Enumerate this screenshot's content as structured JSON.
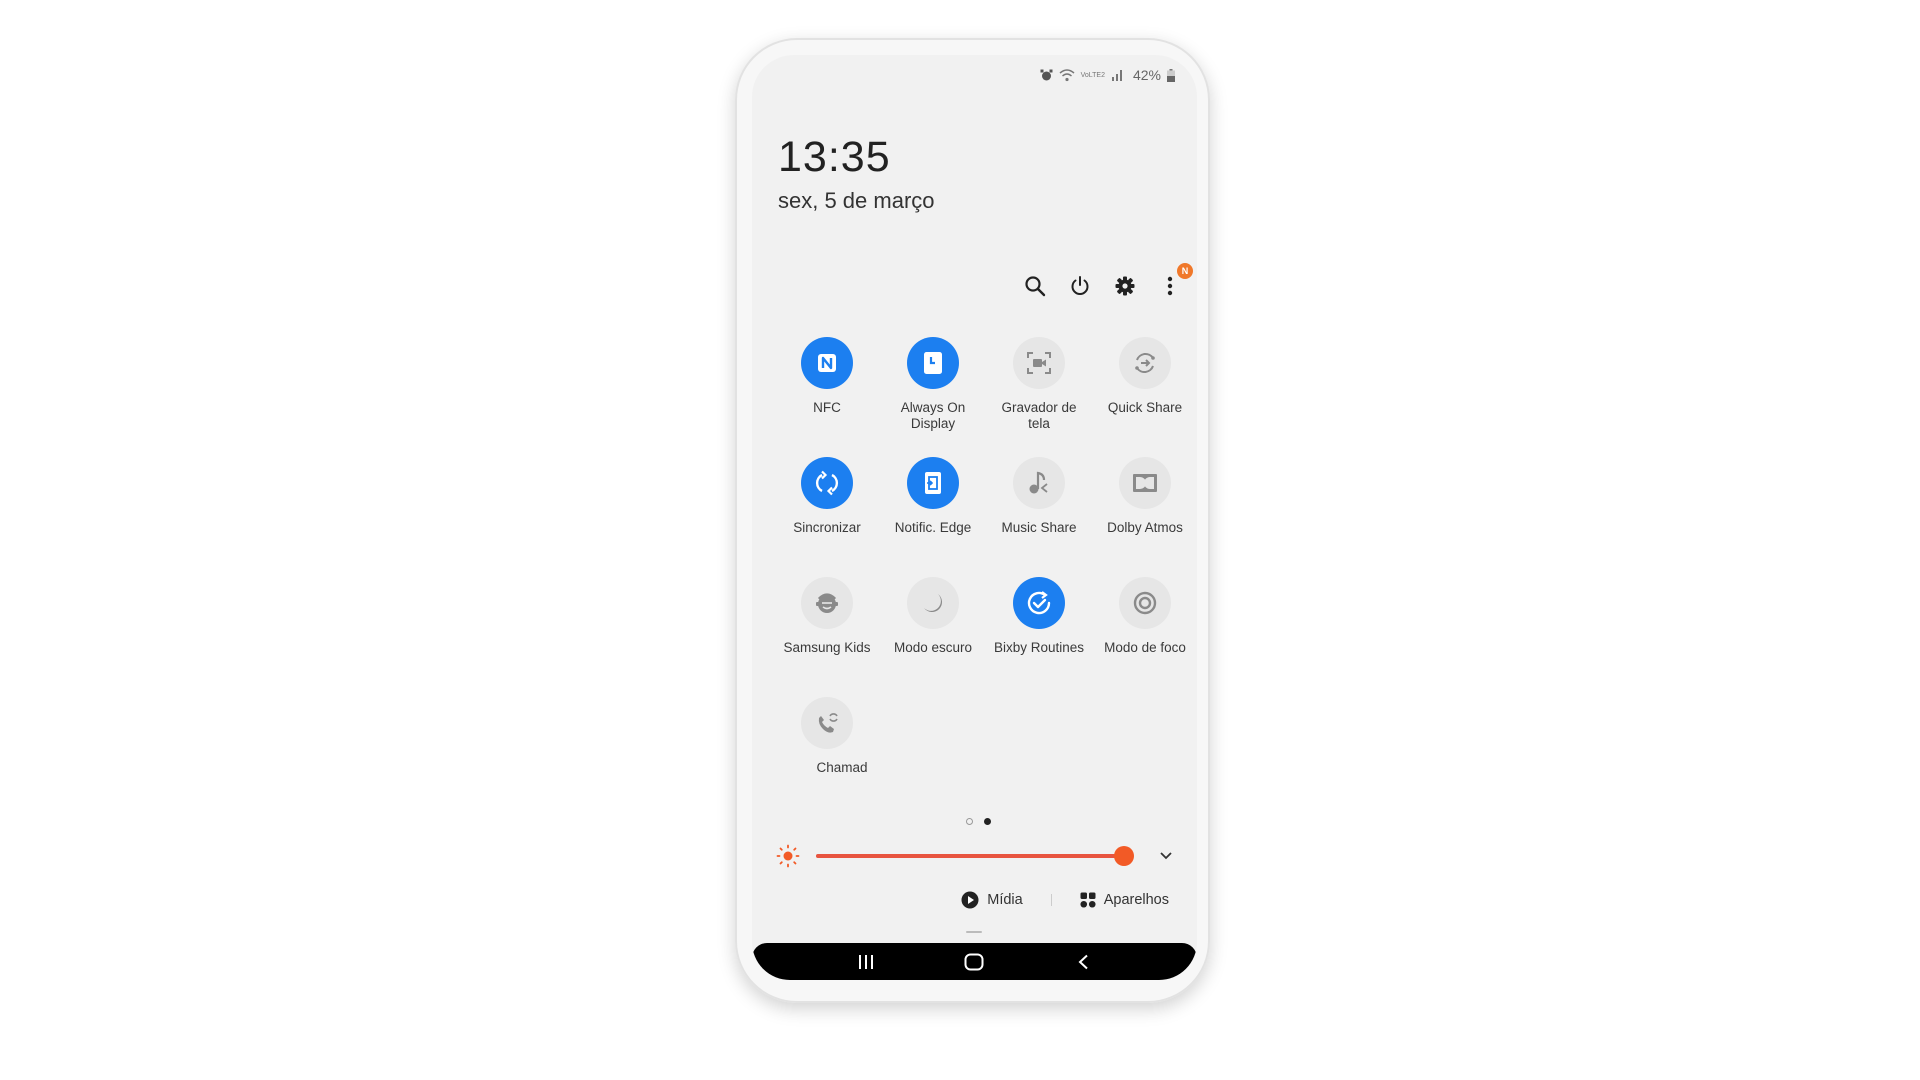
{
  "status_bar": {
    "icons": [
      "alarm-icon",
      "wifi-icon",
      "volte-lte-icon",
      "signal-icon"
    ],
    "volte_label": "VoLTE2",
    "battery_percent": "42%",
    "battery_icon": "battery-icon"
  },
  "clock": {
    "time": "13:35",
    "date": "sex, 5 de março"
  },
  "toolbar": {
    "search_icon": "search-icon",
    "power_icon": "power-icon",
    "settings_icon": "gear-icon",
    "more_icon": "more-vertical-icon",
    "more_badge": "N"
  },
  "colors": {
    "tile_on": "#1c7ff0",
    "tile_off": "#e6e6e6",
    "brightness_accent": "#f25a26",
    "badge": "#f0782a"
  },
  "quick_tiles": [
    {
      "label": "NFC",
      "icon": "nfc-icon",
      "active": true
    },
    {
      "label": "Always On Display",
      "icon": "always-on-display-icon",
      "active": true
    },
    {
      "label": "Gravador de tela",
      "icon": "screen-recorder-icon",
      "active": false
    },
    {
      "label": "Quick Share",
      "icon": "quick-share-icon",
      "active": false
    },
    {
      "label": "Sincronizar",
      "icon": "sync-icon",
      "active": true
    },
    {
      "label": "Notific. Edge",
      "icon": "edge-notification-icon",
      "active": true
    },
    {
      "label": "Music Share",
      "icon": "music-share-icon",
      "active": false
    },
    {
      "label": "Dolby Atmos",
      "icon": "dolby-icon",
      "active": false
    },
    {
      "label": "Samsung Kids",
      "icon": "kids-icon",
      "active": false
    },
    {
      "label": "Modo escuro",
      "icon": "dark-mode-icon",
      "active": false
    },
    {
      "label": "Bixby Routines",
      "icon": "bixby-routines-icon",
      "active": true
    },
    {
      "label": "Modo de foco",
      "icon": "focus-mode-icon",
      "active": false
    },
    {
      "label": "Chamad",
      "icon": "call-sync-icon",
      "active": false
    }
  ],
  "pager": {
    "pages": 2,
    "current": 2
  },
  "brightness": {
    "value_percent": 97,
    "icon": "sun-icon",
    "expand_icon": "chevron-down-icon"
  },
  "media_row": {
    "media_label": "Mídia",
    "devices_label": "Aparelhos"
  },
  "nav_bar": {
    "recents_icon": "recents-icon",
    "home_icon": "home-icon",
    "back_icon": "back-icon"
  }
}
